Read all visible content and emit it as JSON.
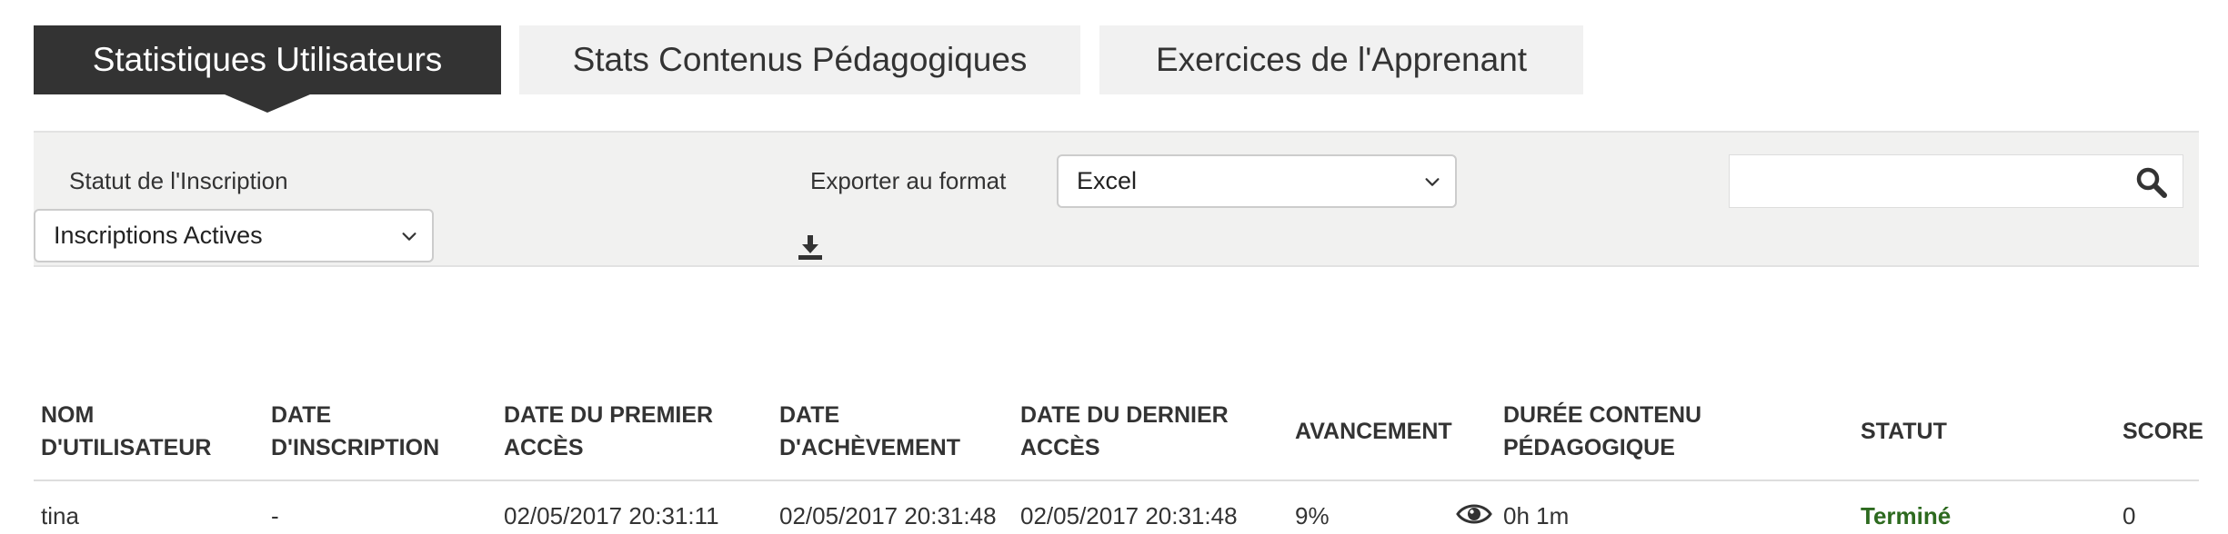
{
  "tabs": [
    {
      "label": "Statistiques Utilisateurs",
      "active": true
    },
    {
      "label": "Stats Contenus Pédagogiques",
      "active": false
    },
    {
      "label": "Exercices de l'Apprenant",
      "active": false
    }
  ],
  "filters": {
    "statut_label": "Statut de l'Inscription",
    "statut_value": "Inscriptions Actives",
    "export_label": "Exporter au format",
    "export_value": "Excel",
    "search_value": ""
  },
  "icons": {
    "download": "download-icon",
    "search": "search-icon",
    "chevron": "chevron-down-icon",
    "view": "eye-icon"
  },
  "colors": {
    "active_tab": "#333333",
    "status_done": "#2d6a1f"
  },
  "table": {
    "headers": [
      "NOM\nD'UTILISATEUR",
      "DATE\nD'INSCRIPTION",
      "DATE DU PREMIER\nACCÈS",
      "DATE\nD'ACHÈVEMENT",
      "DATE DU DERNIER\nACCÈS",
      "AVANCEMENT",
      "DURÉE CONTENU\nPÉDAGOGIQUE",
      "STATUT",
      "SCORE"
    ],
    "rows": [
      {
        "username": "tina",
        "enrollment_date": "-",
        "first_access": "02/05/2017 20:31:11",
        "completion_date": "02/05/2017 20:31:48",
        "last_access": "02/05/2017 20:31:48",
        "progress": "9%",
        "duration": "0h 1m",
        "status": "Terminé",
        "score": "0"
      }
    ]
  }
}
